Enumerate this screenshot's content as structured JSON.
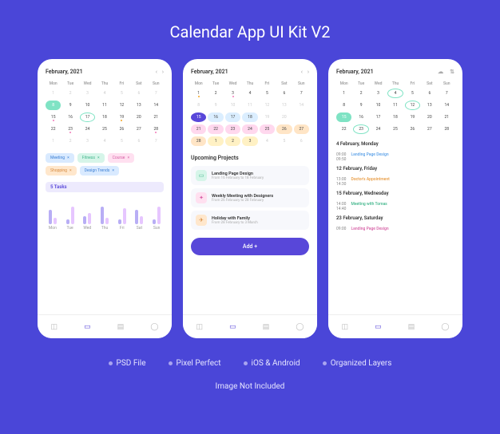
{
  "title": "Calendar App UI Kit V2",
  "features": [
    "PSD File",
    "Pixel Perfect",
    "iOS & Android",
    "Organized Layers"
  ],
  "disclaimer": "Image Not Included",
  "weekdays": [
    "Mon",
    "Tue",
    "Wed",
    "Thu",
    "Fri",
    "Sat",
    "Sun"
  ],
  "chart_data": {
    "type": "bar",
    "categories": [
      "Mon",
      "Tue",
      "Wed",
      "Thu",
      "Fri",
      "Sat",
      "Sun"
    ],
    "series": [
      {
        "name": "a",
        "values": [
          18,
          6,
          10,
          22,
          6,
          18,
          6
        ]
      },
      {
        "name": "b",
        "values": [
          8,
          22,
          14,
          8,
          20,
          10,
          22
        ]
      }
    ],
    "title": "5 Tasks"
  },
  "screens": {
    "s1": {
      "month": "February, 2021",
      "weeks": [
        [
          "dim:1",
          "dim:2",
          "dim:3",
          "dim:4",
          "dim:5",
          "dim:6",
          "dim:7"
        ],
        [
          "today:8",
          "9",
          "10",
          "11",
          "12",
          "13",
          "14"
        ],
        [
          "dot-pink:15",
          "16",
          "circle-green:17",
          "18",
          "dot-orange:19",
          "20",
          "21"
        ],
        [
          "22",
          "dot-pink:23",
          "24",
          "25",
          "26",
          "27",
          "dot-pink:28"
        ],
        [
          "dim:1",
          "dim:2",
          "dim:3",
          "dim:4",
          "dim:5",
          "dim:6",
          "dim:7"
        ]
      ],
      "tags": [
        {
          "label": "Meeting",
          "cls": "tag-blue"
        },
        {
          "label": "Fitness",
          "cls": "tag-green"
        },
        {
          "label": "Course",
          "cls": "tag-pink"
        },
        {
          "label": "Shopping",
          "cls": "tag-orange"
        },
        {
          "label": "Design Trends",
          "cls": "tag-blue"
        }
      ],
      "tasks_label": "5 Tasks"
    },
    "s2": {
      "month": "February, 2021",
      "weeks": [
        [
          "dot-orange:1",
          "2",
          "dot-pink:3",
          "4",
          "5",
          "6",
          "7"
        ],
        [
          "dim:8",
          "dim:9",
          "dim:10",
          "dim:11",
          "dim:12",
          "dim:13",
          "dim:14"
        ],
        [
          "circle-today:15",
          "sel-blue:16",
          "sel-blue:17",
          "sel-blue:18",
          "dim:19",
          "dim:20",
          ""
        ],
        [
          "sel-pink:21",
          "sel-pink:22",
          "sel-pink:23",
          "sel-pink:24",
          "sel-pink:25",
          "sel-orange:26",
          "sel-orange:27"
        ],
        [
          "sel-orange:28",
          "sel-yellow:1",
          "sel-yellow:2",
          "sel-yellow:3",
          "dim:4",
          "dim:5",
          "dim:6"
        ]
      ],
      "subtitle": "Upcoming Projects",
      "projects": [
        {
          "icon": "green",
          "glyph": "▭",
          "title": "Landing Page Design",
          "sub": "From 16 February to 18 February"
        },
        {
          "icon": "pink",
          "glyph": "✦",
          "title": "Weekly Meeting with Designers",
          "sub": "From 26 February to 28 February"
        },
        {
          "icon": "orange",
          "glyph": "✈",
          "title": "Holiday with Family",
          "sub": "From 28 February to 3 March"
        }
      ],
      "add_label": "Add  +"
    },
    "s3": {
      "month": "February, 2021",
      "weeks": [
        [
          "1",
          "2",
          "3",
          "circle-green:4",
          "5",
          "6",
          "7"
        ],
        [
          "8",
          "9",
          "10",
          "11",
          "circle-green:12",
          "13",
          "14"
        ],
        [
          "today:15",
          "16",
          "17",
          "18",
          "19",
          "20",
          "21"
        ],
        [
          "22",
          "circle-green:23",
          "24",
          "25",
          "26",
          "27",
          "28"
        ]
      ],
      "agenda": [
        {
          "day": "4 February, Monday",
          "items": [
            {
              "t1": "09:00",
              "t2": "09:50",
              "title": "Landing Page Design",
              "cls": "blue"
            }
          ]
        },
        {
          "day": "12 February, Friday",
          "items": [
            {
              "t1": "13:00",
              "t2": "14:30",
              "title": "Doctor's Appointment",
              "cls": "orange"
            }
          ]
        },
        {
          "day": "15 February, Wednesday",
          "items": [
            {
              "t1": "14:00",
              "t2": "14:40",
              "title": "Meeting with Tomas",
              "cls": "green"
            }
          ]
        },
        {
          "day": "23 February, Saturday",
          "items": [
            {
              "t1": "09:00",
              "t2": "",
              "title": "Landing Page Design",
              "cls": "pink"
            }
          ]
        }
      ]
    }
  },
  "nav": [
    "◫",
    "▭",
    "▤",
    "◯"
  ]
}
